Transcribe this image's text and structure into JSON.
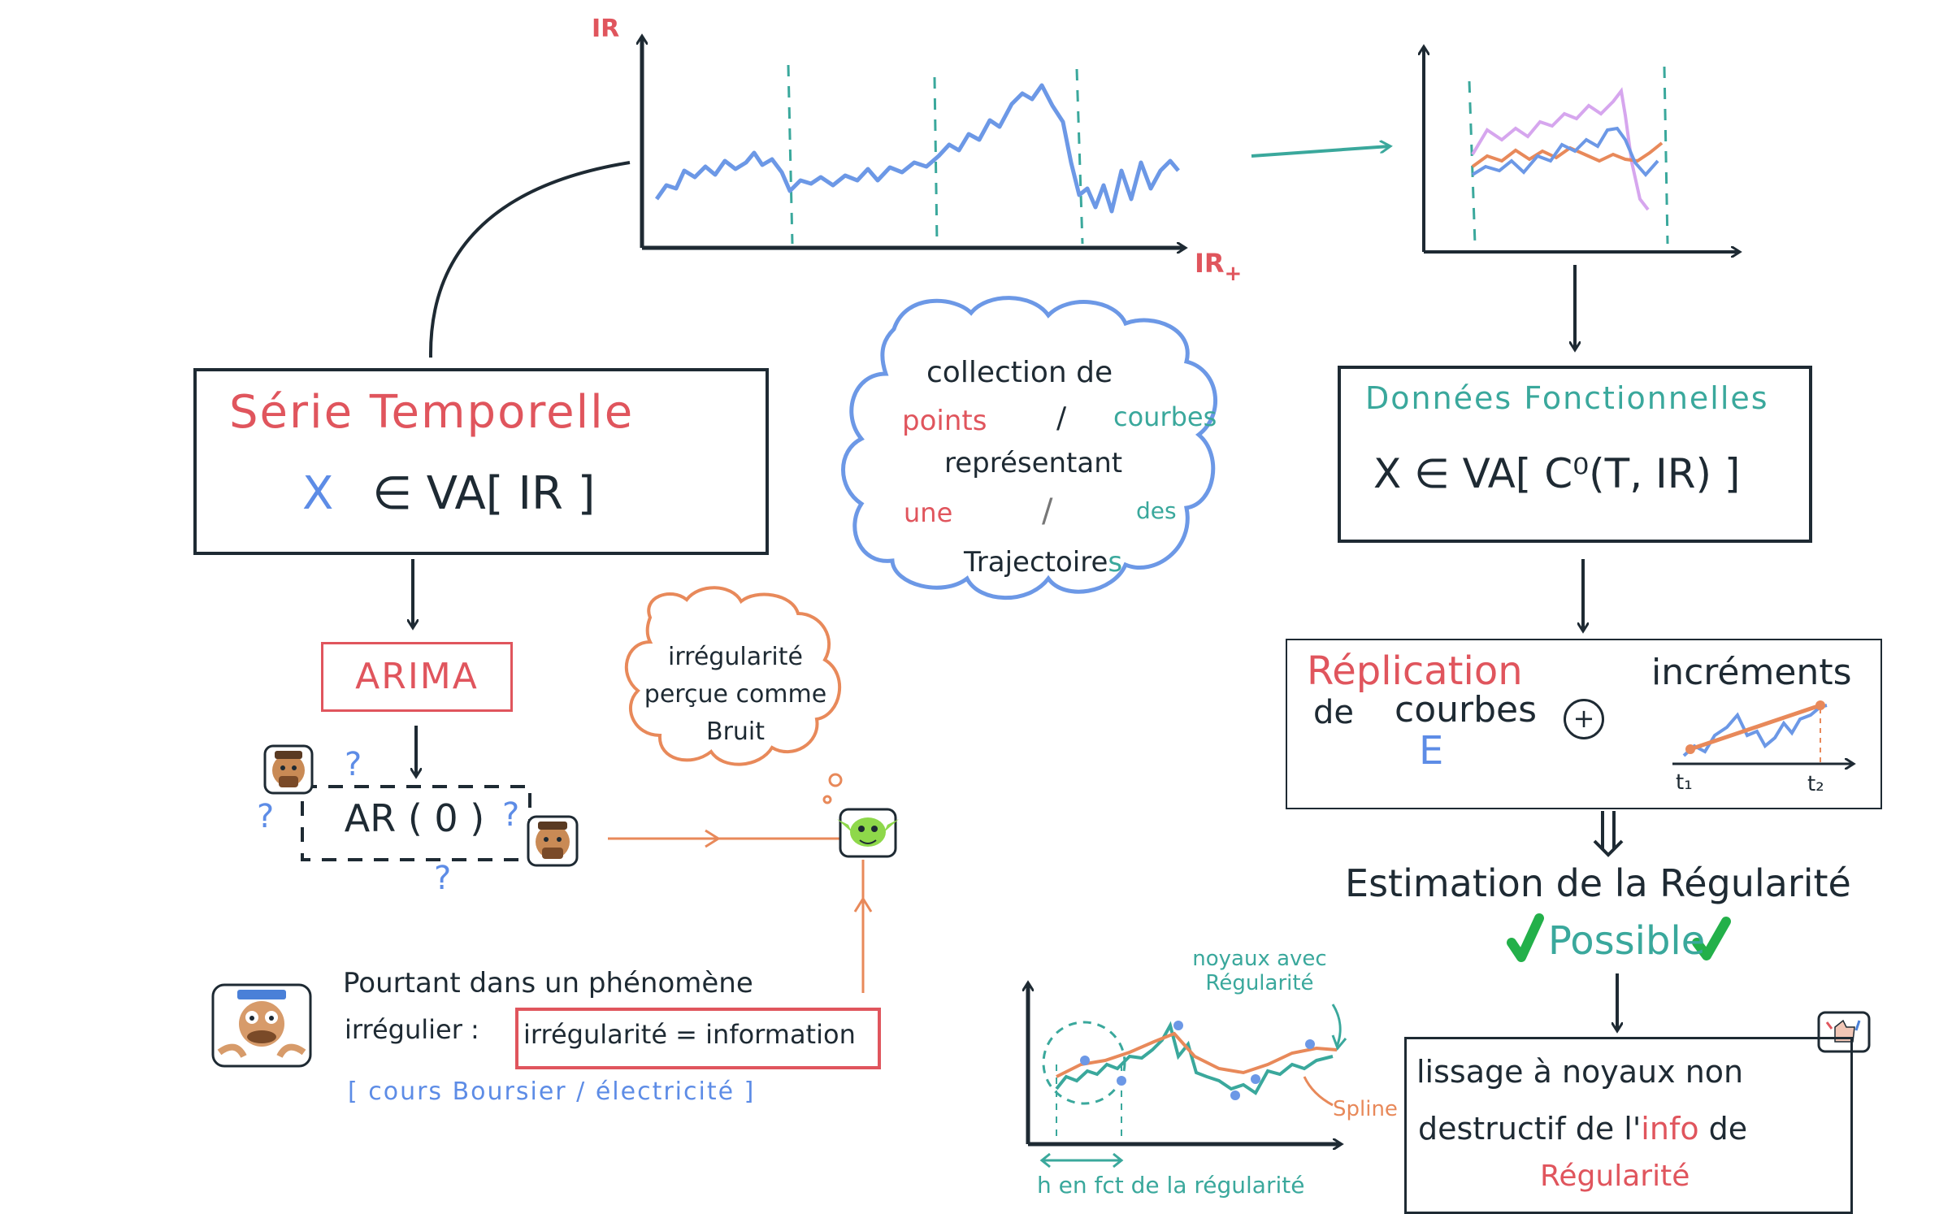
{
  "top_chart": {
    "y_axis_label": "IR",
    "x_axis_label": "IR",
    "x_axis_suffix": "+"
  },
  "serie_temporelle": {
    "title": "Série Temporelle",
    "formula_x": "X",
    "formula_rest": "∈ VA[ IR ]"
  },
  "arima": {
    "label": "ARIMA",
    "ar_label": "AR ( 0 )",
    "question_mark": "?"
  },
  "cloud": {
    "line1": "collection de",
    "points": "points",
    "slash": "/",
    "courbes": "courbes",
    "line3": "représentant",
    "une": "une",
    "des": "des",
    "trajectoire": "Trajectoire",
    "s": "s"
  },
  "thought": {
    "line1": "irrégularité",
    "line2": "perçue comme",
    "line3": "Bruit"
  },
  "donnees": {
    "title": "Données Fonctionnelles",
    "formula": "X ∈ VA[ C⁰(T, IR) ]"
  },
  "replication": {
    "title": "Réplication",
    "de": "de",
    "courbes": "courbes",
    "e_symbol": "E",
    "plus": "+",
    "increments": "incréments",
    "t1": "t₁",
    "t2": "t₂"
  },
  "estimation": {
    "text": "Estimation de la Régularité",
    "possible": "Possible",
    "check": "✔"
  },
  "lissage": {
    "line1": "lissage à noyaux non",
    "line2_a": "destructif de l'",
    "line2_info": "info",
    "line2_b": " de",
    "line3": "Régularité"
  },
  "bottom_chart": {
    "annotation": "noyaux avec Régularité",
    "spline": "Spline",
    "h_label": "h en fct de la régularité"
  },
  "pourtant": {
    "line1": "Pourtant dans un phénomène",
    "line2": "irrégulier :",
    "boxed": "irrégularité = information",
    "examples": "[ cours Boursier / électricité ]"
  },
  "colors": {
    "red": "#e0555d",
    "blue": "#5d8ce6",
    "teal": "#3aa89c",
    "orange": "#e8895a",
    "green": "#23b04a",
    "purple": "#d6a6ee",
    "dark": "#1e2a33"
  }
}
